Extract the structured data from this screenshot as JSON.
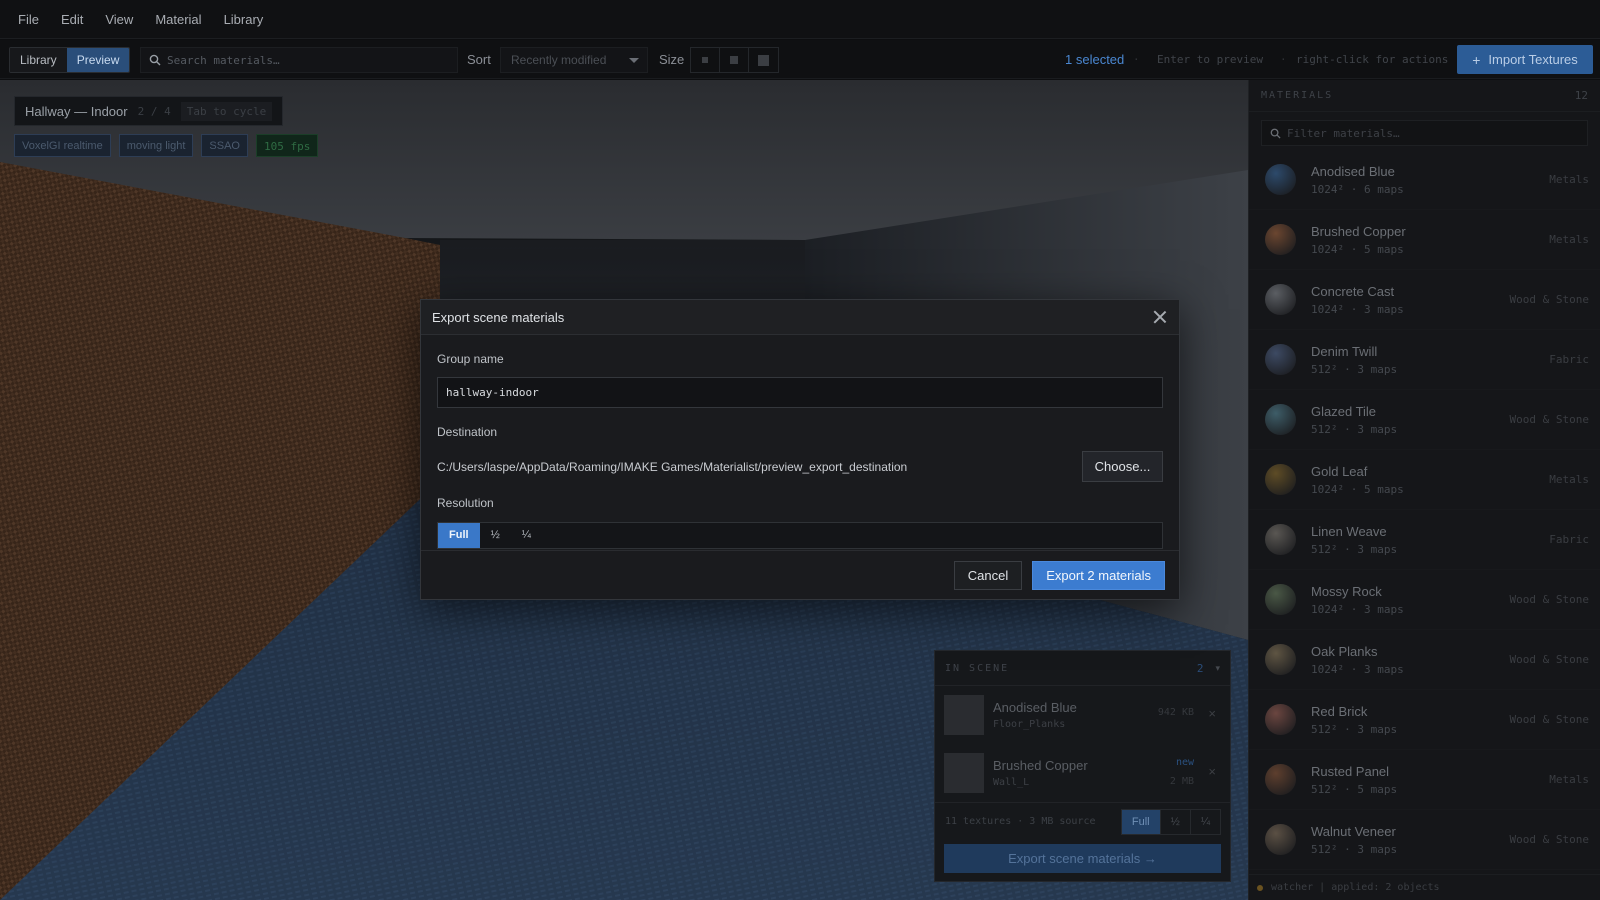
{
  "menubar": {
    "items": [
      "File",
      "Edit",
      "View",
      "Material",
      "Library"
    ]
  },
  "toolbar": {
    "view_tabs": [
      "Library",
      "Preview"
    ],
    "active_tab": "Preview",
    "search_placeholder": "Search materials…",
    "sort_label": "Sort",
    "sort_value": "Recently modified",
    "size_label": "Size",
    "selected_text": "1 selected",
    "hint_preview": "Enter to preview",
    "hint_actions": "right-click for actions",
    "import_label": "Import Textures",
    "import_icon": "plus-icon"
  },
  "viewport": {
    "scene_title": "Hallway — Indoor",
    "scene_page": "2 / 4",
    "scene_hint": "Tab to cycle",
    "badges": [
      "VoxelGI realtime",
      "moving light",
      "SSAO"
    ],
    "fps": "105 fps"
  },
  "inscene": {
    "label": "IN SCENE",
    "count": "2",
    "rows": [
      {
        "name": "Anodised Blue",
        "target": "Floor_Planks",
        "size": "942 KB",
        "tag": ""
      },
      {
        "name": "Brushed Copper",
        "target": "Wall_L",
        "size": "2 MB",
        "tag": "new"
      }
    ],
    "meta": "11 textures · 3 MB source",
    "resolutions": [
      "Full",
      "½",
      "¼"
    ],
    "active_resolution": "Full",
    "export_label": "Export scene materials →"
  },
  "sidebar": {
    "label": "MATERIALS",
    "count": "12",
    "filter_placeholder": "Filter materials…",
    "materials": [
      {
        "name": "Anodised Blue",
        "meta": "1024² · 6 maps",
        "category": "Metals",
        "color": "#2d4a6b"
      },
      {
        "name": "Brushed Copper",
        "meta": "1024² · 5 maps",
        "category": "Metals",
        "color": "#6b4630"
      },
      {
        "name": "Concrete Cast",
        "meta": "1024² · 3 maps",
        "category": "Wood & Stone",
        "color": "#5b5e63"
      },
      {
        "name": "Denim Twill",
        "meta": "512² · 3 maps",
        "category": "Fabric",
        "color": "#3d4a63"
      },
      {
        "name": "Glazed Tile",
        "meta": "512² · 3 maps",
        "category": "Wood & Stone",
        "color": "#3e5d68"
      },
      {
        "name": "Gold Leaf",
        "meta": "1024² · 5 maps",
        "category": "Metals",
        "color": "#5e4c26"
      },
      {
        "name": "Linen Weave",
        "meta": "512² · 3 maps",
        "category": "Fabric",
        "color": "#5a5753"
      },
      {
        "name": "Mossy Rock",
        "meta": "1024² · 3 maps",
        "category": "Wood & Stone",
        "color": "#4a5846"
      },
      {
        "name": "Oak Planks",
        "meta": "1024² · 3 maps",
        "category": "Wood & Stone",
        "color": "#5f5543"
      },
      {
        "name": "Red Brick",
        "meta": "512² · 3 maps",
        "category": "Wood & Stone",
        "color": "#6b4640"
      },
      {
        "name": "Rusted Panel",
        "meta": "512² · 5 maps",
        "category": "Metals",
        "color": "#5e3f2e"
      },
      {
        "name": "Walnut Veneer",
        "meta": "512² · 3 maps",
        "category": "Wood & Stone",
        "color": "#5b5044"
      }
    ],
    "status": "watcher  |  applied: 2 objects"
  },
  "modal": {
    "title": "Export scene materials",
    "group_name_label": "Group name",
    "group_name_value": "hallway-indoor",
    "destination_label": "Destination",
    "destination_path": "C:/Users/laspe/AppData/Roaming/IMAKE Games/Materialist/preview_export_destination",
    "choose_label": "Choose...",
    "resolution_label": "Resolution",
    "resolutions": [
      "Full",
      "½",
      "¼"
    ],
    "active_resolution": "Full",
    "cancel_label": "Cancel",
    "export_label": "Export 2 materials"
  },
  "colors": {
    "accent": "#3c7cd0",
    "selected_text": "#4a87d1",
    "fps_badge": "#2f6b43"
  }
}
